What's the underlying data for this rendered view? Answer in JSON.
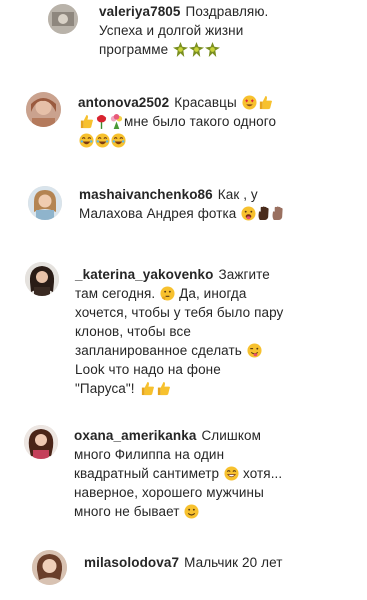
{
  "comments": [
    {
      "username": "valeriya7805",
      "lines": [
        "Поздравляю.",
        "Успеха и долгой жизни",
        "программе"
      ],
      "emoji_after_last_line": [
        "sparkle-icon",
        "sparkle-icon",
        "sparkle-icon"
      ]
    },
    {
      "username": "antonova2502",
      "lines": [
        "Красавцы",
        "мне было такого одного",
        ""
      ],
      "emoji_line1": [
        "heart-eyes-face-icon",
        "thumbs-up-icon"
      ],
      "emoji_line2": [
        "thumbs-up-icon",
        "rose-icon",
        "bouquet-icon"
      ],
      "emoji_line3": [
        "laughing-face-icon",
        "laughing-face-icon",
        "laughing-face-icon"
      ]
    },
    {
      "username": "mashaivanchenko86",
      "lines": [
        "Как , у",
        "Малахова Андрея фотка"
      ],
      "emoji_after_last_line": [
        "tongue-face-icon",
        "dark-hand-icon",
        "hand-icon"
      ]
    },
    {
      "username": "_katerina_yakovenko",
      "lines": [
        "Зажгите",
        "там сегодня.",
        "Да, иногда",
        "хочется, чтобы у тебя было пару",
        "клонов, чтобы все",
        "запланированное сделать",
        "Look что надо на фоне",
        "\"Паруса\"!"
      ],
      "emoji_line2": [
        "thinking-face-icon"
      ],
      "emoji_line6": [
        "wink-tongue-face-icon"
      ],
      "emoji_line8": [
        "thumbs-up-icon",
        "thumbs-up-icon"
      ]
    },
    {
      "username": "oxana_amerikanka",
      "lines": [
        "Слишком",
        "много Филиппа на один",
        "квадратный сантиметр",
        "хотя...",
        "наверное, хорошего мужчины",
        "много не бывает"
      ],
      "emoji_line3": [
        "grinning-face-icon"
      ],
      "emoji_line6": [
        "smiling-face-icon"
      ]
    },
    {
      "username": "milasolodova7",
      "lines": [
        "Мальчик 20 лет"
      ]
    }
  ]
}
